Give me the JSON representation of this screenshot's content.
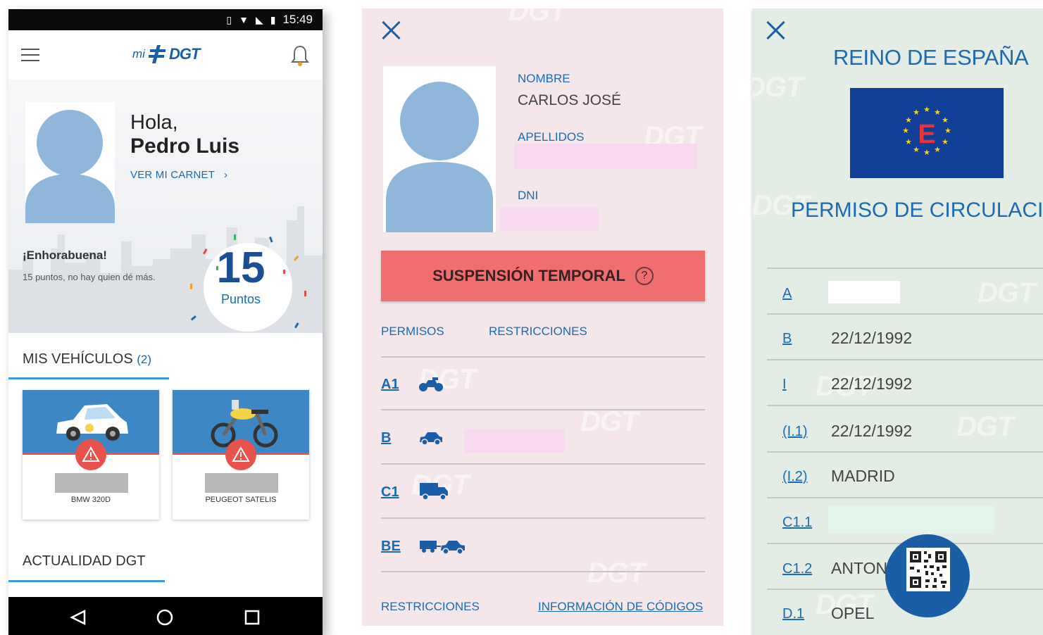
{
  "phone": {
    "status_time": "15:49",
    "logo_mi": "mi",
    "logo_dgt": "DGT",
    "greeting": "Hola,",
    "user_name": "Pedro Luis",
    "view_card_link": "VER MI CARNET",
    "congrats_title": "¡Enhorabuena!",
    "congrats_text": "15 puntos, no hay quien dé más.",
    "points_value": "15",
    "points_label": "Puntos",
    "vehicles_title": "MIS VEHÍCULOS",
    "vehicles_count": "(2)",
    "vehicles": [
      {
        "model": "BMW 320D"
      },
      {
        "model": "PEUGEOT SATELIS"
      }
    ],
    "news_title": "ACTUALIDAD DGT"
  },
  "licence": {
    "name_label": "NOMBRE",
    "name_value": "CARLOS JOSÉ",
    "surname_label": "APELLIDOS",
    "dni_label": "DNI",
    "suspension_label": "SUSPENSIÓN TEMPORAL",
    "suspension_help": "?",
    "tabs": [
      "PERMISOS",
      "RESTRICCIONES"
    ],
    "classes": [
      {
        "code": "A1"
      },
      {
        "code": "B"
      },
      {
        "code": "C1"
      },
      {
        "code": "BE"
      }
    ],
    "footer_left": "RESTRICCIONES",
    "footer_right": "INFORMACIÓN DE CÓDIGOS"
  },
  "circulation": {
    "country": "REINO DE ESPAÑA",
    "flag_letter": "E",
    "title": "PERMISO DE CIRCULACIÓN",
    "rows": [
      {
        "code": "A",
        "value": ""
      },
      {
        "code": "B",
        "value": "22/12/1992"
      },
      {
        "code": "I",
        "value": "22/12/1992"
      },
      {
        "code": "(I.1)",
        "value": "22/12/1992"
      },
      {
        "code": "(I.2)",
        "value": "MADRID"
      },
      {
        "code": "C1.1",
        "value": ""
      },
      {
        "code": "C1.2",
        "value": "ANTONI"
      },
      {
        "code": "D.1",
        "value": "OPEL"
      }
    ]
  },
  "watermark": "DGT",
  "colors": {
    "brand_blue": "#1a5ea8",
    "alert_red": "#ef6f6f",
    "licence_bg": "#f5e6e9",
    "circulation_bg": "#e3ece5"
  }
}
